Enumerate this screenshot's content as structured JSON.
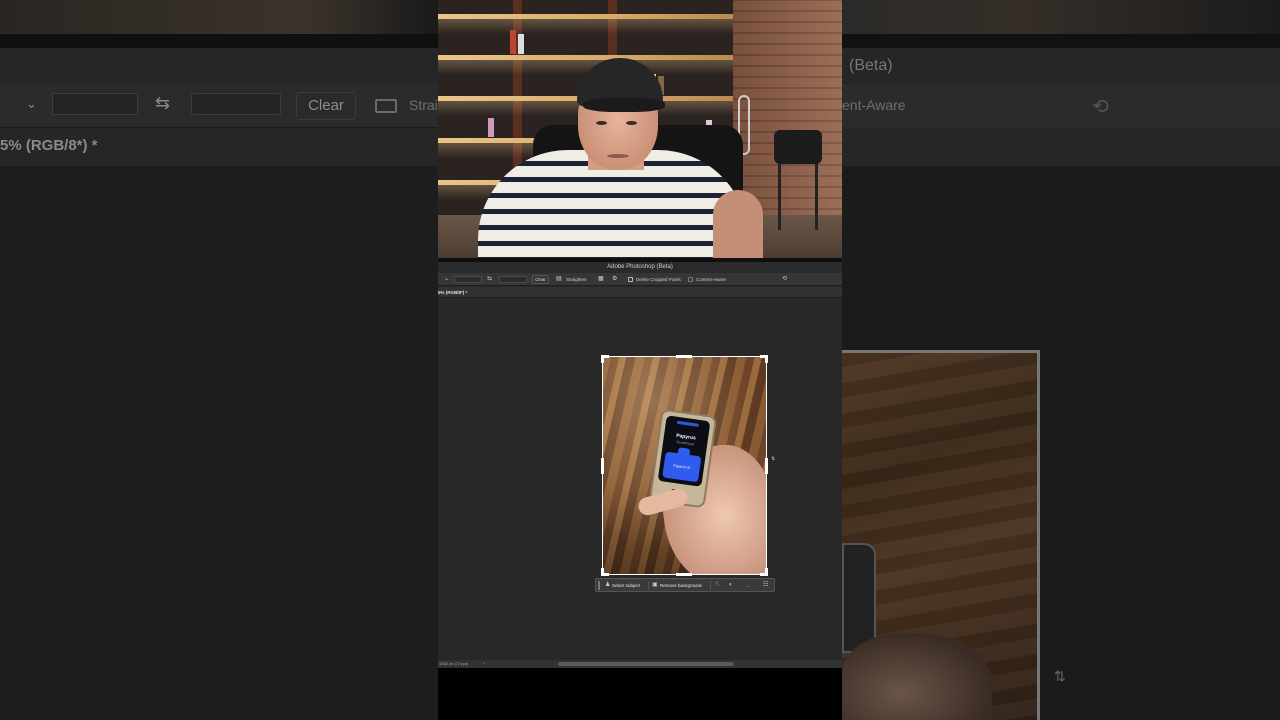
{
  "background_left": {
    "clear_label": "Clear",
    "straighten_partial": "Strai",
    "doc_tab_partial": "5% (RGB/8*) *"
  },
  "background_right": {
    "title_partial": "(Beta)",
    "content_aware_partial": "ent-Aware"
  },
  "photoshop": {
    "app_title": "Adobe Photoshop (Beta)",
    "options": {
      "clear_label": "Clear",
      "straighten_label": "Straighten",
      "delete_cropped_label": "Delete Cropped Pixels",
      "content_aware_label": "Content-Aware"
    },
    "doc_tab": "5% (RGB/8*) *",
    "status_text": "4032 px (72 ppi)",
    "device_screen": {
      "title": "Papyrus",
      "subtitle": "Scratchpad",
      "card_label": "PaperUI AI"
    },
    "contextual_bar": {
      "select_subject": "Select subject",
      "remove_background": "Remove background",
      "more": "…"
    }
  },
  "icons": {
    "swap": "swap-icon",
    "grid": "grid-overlay-icon",
    "settings": "gear-icon",
    "undo": "reset-icon"
  }
}
